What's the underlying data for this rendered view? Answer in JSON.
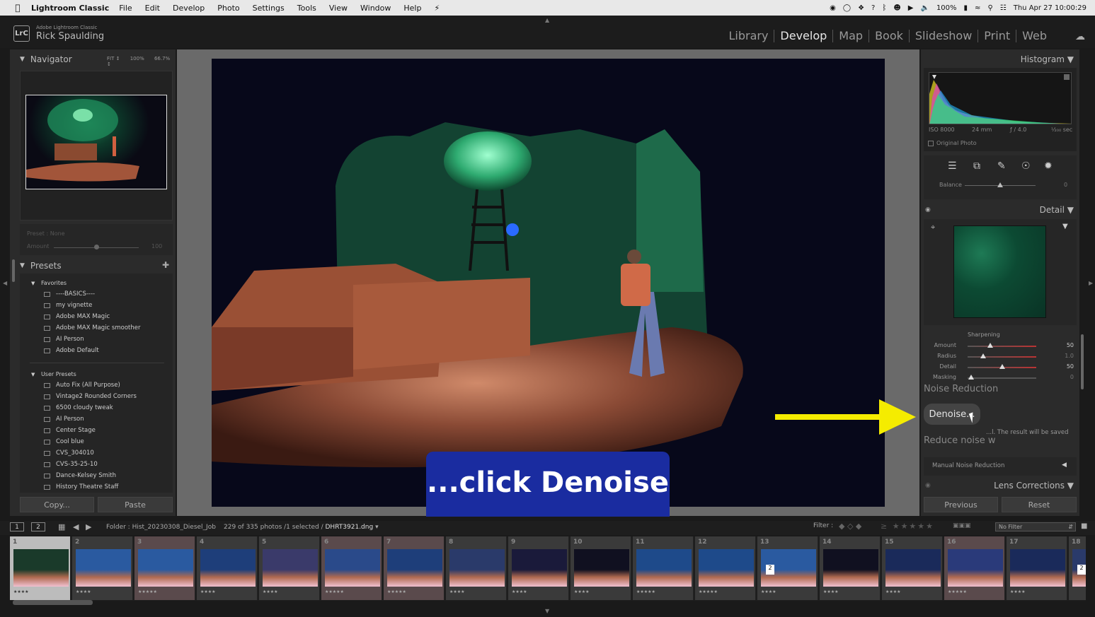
{
  "menubar": {
    "app_name": "Lightroom Classic",
    "items": [
      "File",
      "Edit",
      "Develop",
      "Photo",
      "Settings",
      "Tools",
      "View",
      "Window",
      "Help"
    ],
    "battery": "100%",
    "datetime": "Thu Apr 27  10:00:29"
  },
  "identity": {
    "logo": "LrC",
    "product": "Adobe Lightroom Classic",
    "user": "Rick Spaulding"
  },
  "modules": [
    "Library",
    "Develop",
    "Map",
    "Book",
    "Slideshow",
    "Print",
    "Web"
  ],
  "active_module": "Develop",
  "left_panel": {
    "navigator": {
      "title": "Navigator",
      "fit": "FIT ↕",
      "z100": "100%",
      "z667": "66.7% ↕"
    },
    "preview": {
      "preset_label": "Preset : None",
      "amount_label": "Amount",
      "amount_value": "100",
      "amount_level": 0.5
    },
    "presets": {
      "title": "Presets",
      "groups": [
        {
          "name": "Favorites",
          "items": [
            "----BASICS----",
            "my vignette",
            "Adobe MAX Magic",
            "Adobe MAX Magic smoother",
            "AI Person",
            "Adobe Default"
          ]
        },
        {
          "name": "User Presets",
          "items": [
            "Auto Fix (All Purpose)",
            "Vintage2 Rounded Corners",
            "6500 cloudy tweak",
            "AI Person",
            "Center Stage",
            "Cool blue",
            "CVS_304010",
            "CVS-35-25-10",
            "Dance-Kelsey Smith",
            "History Theatre Staff"
          ]
        }
      ]
    },
    "copy_button": "Copy...",
    "paste_button": "Paste"
  },
  "caption": "...click Denoise",
  "right_panel": {
    "histogram_title": "Histogram ▼",
    "exif": {
      "iso": "ISO 8000",
      "focal": "24 mm",
      "aperture": "ƒ / 4.0",
      "shutter": "¹⁄₂₀₀ sec"
    },
    "original_photo": "Original Photo",
    "balance_label": "Balance",
    "balance_value": "0",
    "balance_level": 0.5,
    "detail_title": "Detail ▼",
    "sharpening": {
      "title": "Sharpening",
      "rows": [
        {
          "label": "Amount",
          "value": "50",
          "level": 0.33
        },
        {
          "label": "Radius",
          "value": "1.0",
          "level": 0.23
        },
        {
          "label": "Detail",
          "value": "50",
          "level": 0.5
        },
        {
          "label": "Masking",
          "value": "0",
          "level": 0.05
        }
      ]
    },
    "noise_reduction_title": "Noise Reduction",
    "denoise_button": "Denoise...",
    "denoise_note": "...l. The result will be saved",
    "reduce_noise": "Reduce noise w",
    "manual_nr": "Manual Noise Reduction",
    "lens_title": "Lens Corrections ▼",
    "previous_button": "Previous",
    "reset_button": "Reset"
  },
  "filmstrip_bar": {
    "view1": "1",
    "view2": "2",
    "folder": "Folder : Hist_20230308_Diesel_Job",
    "count": "229 of 335 photos /1 selected /",
    "filename": "DHRT3921.dng",
    "filter_label": "Filter :",
    "no_filter": "No Filter"
  },
  "filmstrip": [
    {
      "n": "1",
      "sel": true,
      "stars": "★★★★",
      "bg": "#1a3a2a"
    },
    {
      "n": "2",
      "stars": "★★★★",
      "bg": "#2a5aa0"
    },
    {
      "n": "3",
      "pink": true,
      "stars": "★★★★★",
      "bg": "#2a5aa0"
    },
    {
      "n": "4",
      "stars": "★★★★",
      "bg": "#1e3e7a"
    },
    {
      "n": "5",
      "stars": "★★★★",
      "bg": "#3a3a6a"
    },
    {
      "n": "6",
      "pink": true,
      "stars": "★★★★★",
      "bg": "#2a4a8a"
    },
    {
      "n": "7",
      "pink": true,
      "stars": "★★★★★",
      "bg": "#1e3e7a"
    },
    {
      "n": "8",
      "stars": "★★★★",
      "bg": "#2a3a6a"
    },
    {
      "n": "9",
      "stars": "★★★★",
      "bg": "#1a1a3a"
    },
    {
      "n": "10",
      "stars": "★★★★",
      "bg": "#101020"
    },
    {
      "n": "11",
      "stars": "★★★★★",
      "bg": "#1e4a8a"
    },
    {
      "n": "12",
      "stars": "★★★★★",
      "bg": "#1e4a8a"
    },
    {
      "n": "13",
      "stars": "★★★★",
      "bg": "#2a5aa0",
      "copies": "2"
    },
    {
      "n": "14",
      "stars": "★★★★",
      "bg": "#101020"
    },
    {
      "n": "15",
      "stars": "★★★★",
      "bg": "#1a2a5a"
    },
    {
      "n": "16",
      "pink": true,
      "stars": "★★★★★",
      "bg": "#2a3a7a"
    },
    {
      "n": "17",
      "stars": "★★★★",
      "bg": "#1a2a5a"
    },
    {
      "n": "18",
      "stars": "",
      "bg": "#2a3a6a",
      "copies": "2"
    }
  ]
}
